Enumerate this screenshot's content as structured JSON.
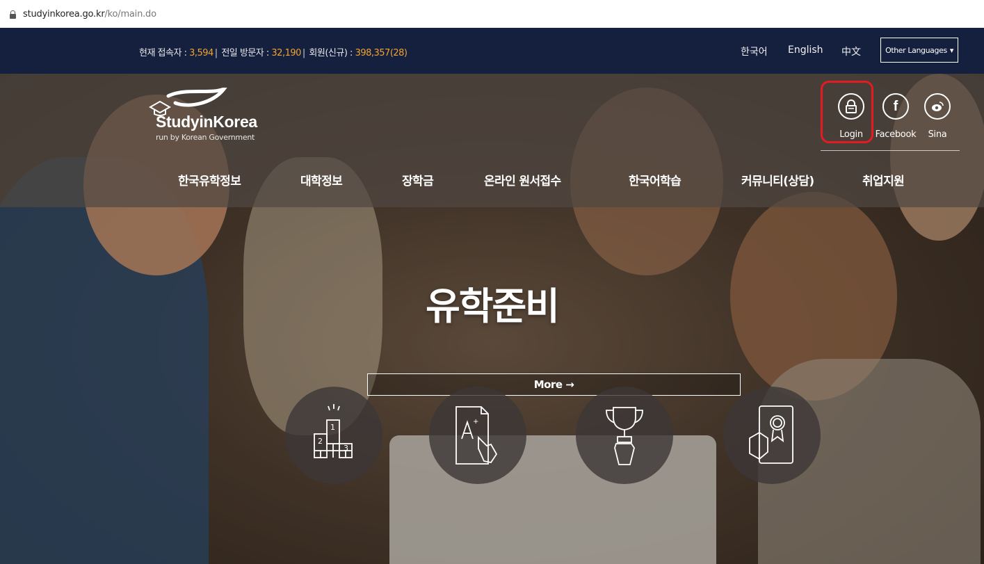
{
  "browser": {
    "url_host": "studyinkorea.go.kr",
    "url_path": "/ko/main.do"
  },
  "topbar": {
    "stats": {
      "current_label": "현재 접속자 : ",
      "current_value": "3,594",
      "yesterday_label": " 전일 방문자 : ",
      "yesterday_value": "32,190",
      "members_label": " 회원(신규) : ",
      "members_value": "398,357(28)"
    },
    "languages": [
      "한국어",
      "English",
      "中文"
    ],
    "other_languages": "Other Languages"
  },
  "logo": {
    "name": "StudyinKorea",
    "sub": "run by Korean Government"
  },
  "social": {
    "login": "Login",
    "facebook": "Facebook",
    "sina": "Sina"
  },
  "nav": [
    "한국유학정보",
    "대학정보",
    "장학금",
    "온라인 원서접수",
    "한국어학습",
    "커뮤니티(상담)",
    "취업지원"
  ],
  "hero": {
    "title": "유학준비",
    "more": "More →"
  },
  "icons": [
    "podium-icon",
    "grade-document-icon",
    "trophy-icon",
    "certificate-icon"
  ],
  "colors": {
    "topbar": "#15203f",
    "stat_number": "#f0a430",
    "highlight": "#e31b23"
  }
}
